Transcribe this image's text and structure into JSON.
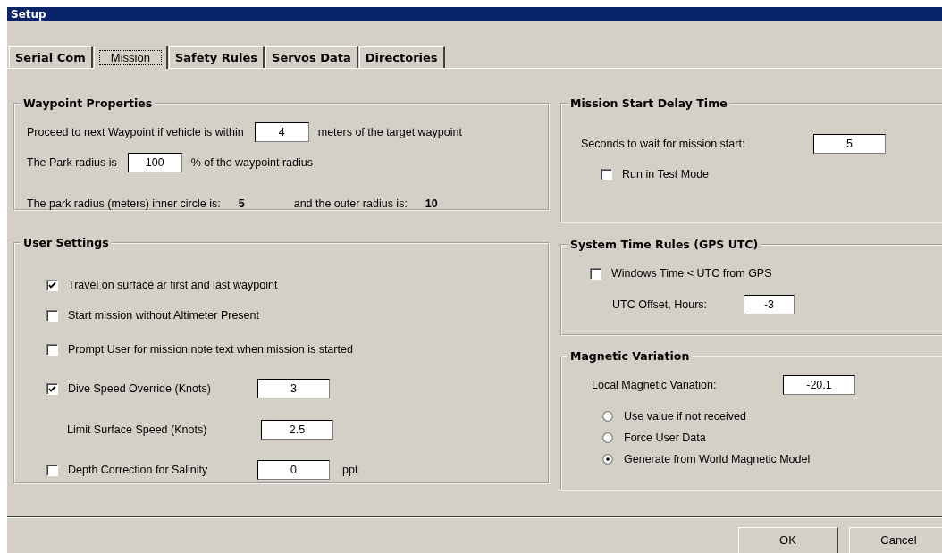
{
  "window": {
    "title": "Setup"
  },
  "tabs": [
    {
      "label": "Serial Com",
      "selected": false
    },
    {
      "label": "Mission",
      "selected": true
    },
    {
      "label": "Safety Rules",
      "selected": false
    },
    {
      "label": "Servos Data",
      "selected": false
    },
    {
      "label": "Directories",
      "selected": false
    }
  ],
  "left_panel": [
    {
      "title": "Waypoint Properties",
      "rows": [
        {
          "parts": [
            {
              "kind": "text",
              "text": "Proceed to next Waypoint if vehicle is within"
            },
            {
              "kind": "field",
              "value": "4"
            },
            {
              "kind": "text",
              "text": "meters of the target waypoint"
            }
          ]
        },
        {
          "parts": [
            {
              "kind": "text",
              "text": "The Park radius is"
            },
            {
              "kind": "field",
              "value": "100"
            },
            {
              "kind": "text",
              "text": "% of the waypoint radius"
            }
          ]
        },
        {
          "parts": [
            {
              "kind": "text",
              "text": "The park radius (meters) inner circle is:"
            },
            {
              "kind": "bold",
              "text": "5"
            },
            {
              "kind": "text",
              "text": "and the outer radius is:"
            },
            {
              "kind": "bold",
              "text": "10"
            }
          ]
        }
      ]
    },
    {
      "title": "User Settings",
      "rows": [
        {
          "parts": [
            {
              "kind": "checkbox",
              "label": "Travel on surface ar first and last waypoint",
              "checked": true
            }
          ]
        },
        {
          "parts": [
            {
              "kind": "checkbox",
              "label": "Start mission without Altimeter Present",
              "checked": false
            }
          ]
        },
        {
          "parts": [
            {
              "kind": "checkbox",
              "label": "Prompt User for mission note text when mission is started",
              "checked": false
            }
          ]
        },
        {
          "parts": [
            {
              "kind": "checkbox",
              "label": "Dive Speed Override (Knots)",
              "checked": true
            },
            {
              "kind": "field",
              "value": "3"
            }
          ]
        },
        {
          "parts": [
            {
              "kind": "text",
              "text": "Limit Surface Speed (Knots)"
            },
            {
              "kind": "field",
              "value": "2.5"
            }
          ]
        },
        {
          "parts": [
            {
              "kind": "checkbox",
              "label": "Depth Correction for Salinity",
              "checked": false
            },
            {
              "kind": "field",
              "value": "0"
            },
            {
              "kind": "text",
              "text": "ppt"
            }
          ]
        }
      ]
    }
  ],
  "right_panel": [
    {
      "title": "Mission Start Delay Time",
      "rows": [
        {
          "parts": [
            {
              "kind": "text",
              "text": "Seconds to wait for mission start:"
            },
            {
              "kind": "field",
              "value": "5"
            }
          ]
        },
        {
          "parts": [
            {
              "kind": "checkbox",
              "label": "Run in Test Mode",
              "checked": false
            }
          ]
        }
      ]
    },
    {
      "title": "System Time Rules (GPS UTC)",
      "rows": [
        {
          "parts": [
            {
              "kind": "checkbox",
              "label": "Windows Time < UTC from GPS",
              "checked": false
            }
          ]
        },
        {
          "parts": [
            {
              "kind": "text",
              "text": "UTC Offset, Hours:"
            },
            {
              "kind": "field",
              "value": "-3"
            }
          ]
        }
      ]
    },
    {
      "title": "Magnetic Variation",
      "rows": [
        {
          "parts": [
            {
              "kind": "text",
              "text": "Local Magnetic Variation:"
            },
            {
              "kind": "field",
              "value": "-20.1"
            }
          ]
        },
        {
          "parts": [
            {
              "kind": "radio",
              "label": "Use value if not received",
              "selected": false
            }
          ]
        },
        {
          "parts": [
            {
              "kind": "radio",
              "label": "Force User Data",
              "selected": false
            }
          ]
        },
        {
          "parts": [
            {
              "kind": "radio",
              "label": "Generate from World Magnetic Model",
              "selected": true
            }
          ]
        }
      ]
    }
  ],
  "buttons": [
    {
      "label": "OK"
    },
    {
      "label": "Cancel"
    }
  ]
}
